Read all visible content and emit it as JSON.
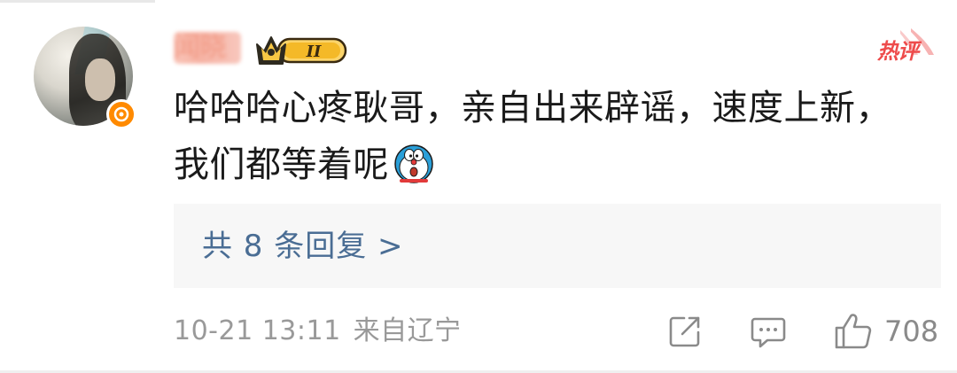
{
  "comment": {
    "username": "闻晓",
    "text": "哈哈哈心疼耿哥，亲自出来辟谣，速度上新，我们都等着呢",
    "emoji": "doraemon-emoji",
    "hot_label": "热评",
    "vip_level": "II"
  },
  "replies": {
    "label": "共 8 条回复 >"
  },
  "footer": {
    "time": "10-21 13:11",
    "location": "来自辽宁",
    "like_count": "708"
  },
  "icons": {
    "verified": "verified-badge-icon",
    "share": "share-icon",
    "comment": "comment-icon",
    "like": "thumbs-up-icon"
  },
  "colors": {
    "link": "#4a6d94",
    "hot": "#ee4b4b",
    "meta": "#999999",
    "vip_gold": "#f4b928"
  }
}
